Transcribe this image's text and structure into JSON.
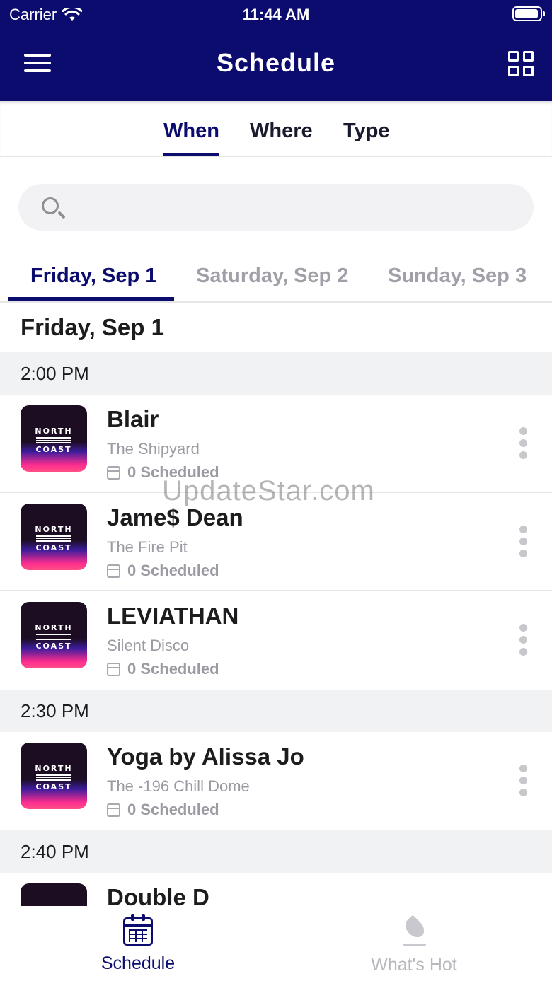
{
  "status_bar": {
    "carrier": "Carrier",
    "time": "11:44 AM"
  },
  "nav": {
    "title": "Schedule"
  },
  "filter_tabs": [
    "When",
    "Where",
    "Type"
  ],
  "search": {
    "placeholder": ""
  },
  "day_tabs": [
    "Friday, Sep 1",
    "Saturday, Sep 2",
    "Sunday, Sep 3"
  ],
  "day_heading": "Friday, Sep 1",
  "thumb_logo": {
    "line1": "NORTH",
    "line2": "COAST"
  },
  "groups": [
    {
      "time": "2:00 PM",
      "events": [
        {
          "title": "Blair",
          "location": "The Shipyard",
          "scheduled": "0 Scheduled"
        },
        {
          "title": "Jame$ Dean",
          "location": "The Fire Pit",
          "scheduled": "0 Scheduled"
        },
        {
          "title": "LEVIATHAN",
          "location": "Silent Disco",
          "scheduled": "0 Scheduled"
        }
      ]
    },
    {
      "time": "2:30 PM",
      "events": [
        {
          "title": "Yoga by Alissa Jo",
          "location": "The -196 Chill Dome",
          "scheduled": "0 Scheduled"
        }
      ]
    },
    {
      "time": "2:40 PM",
      "events": [
        {
          "title": "Double D",
          "location": "",
          "scheduled": ""
        }
      ]
    }
  ],
  "bottom_tabs": [
    {
      "label": "Schedule",
      "icon": "calendar-icon",
      "active": true
    },
    {
      "label": "What's Hot",
      "icon": "flame-icon",
      "active": false
    }
  ],
  "watermark": "UpdateStar.com",
  "colors": {
    "primary": "#0b0c6e",
    "muted": "#9b9ba3",
    "section_bg": "#f1f2f4"
  }
}
